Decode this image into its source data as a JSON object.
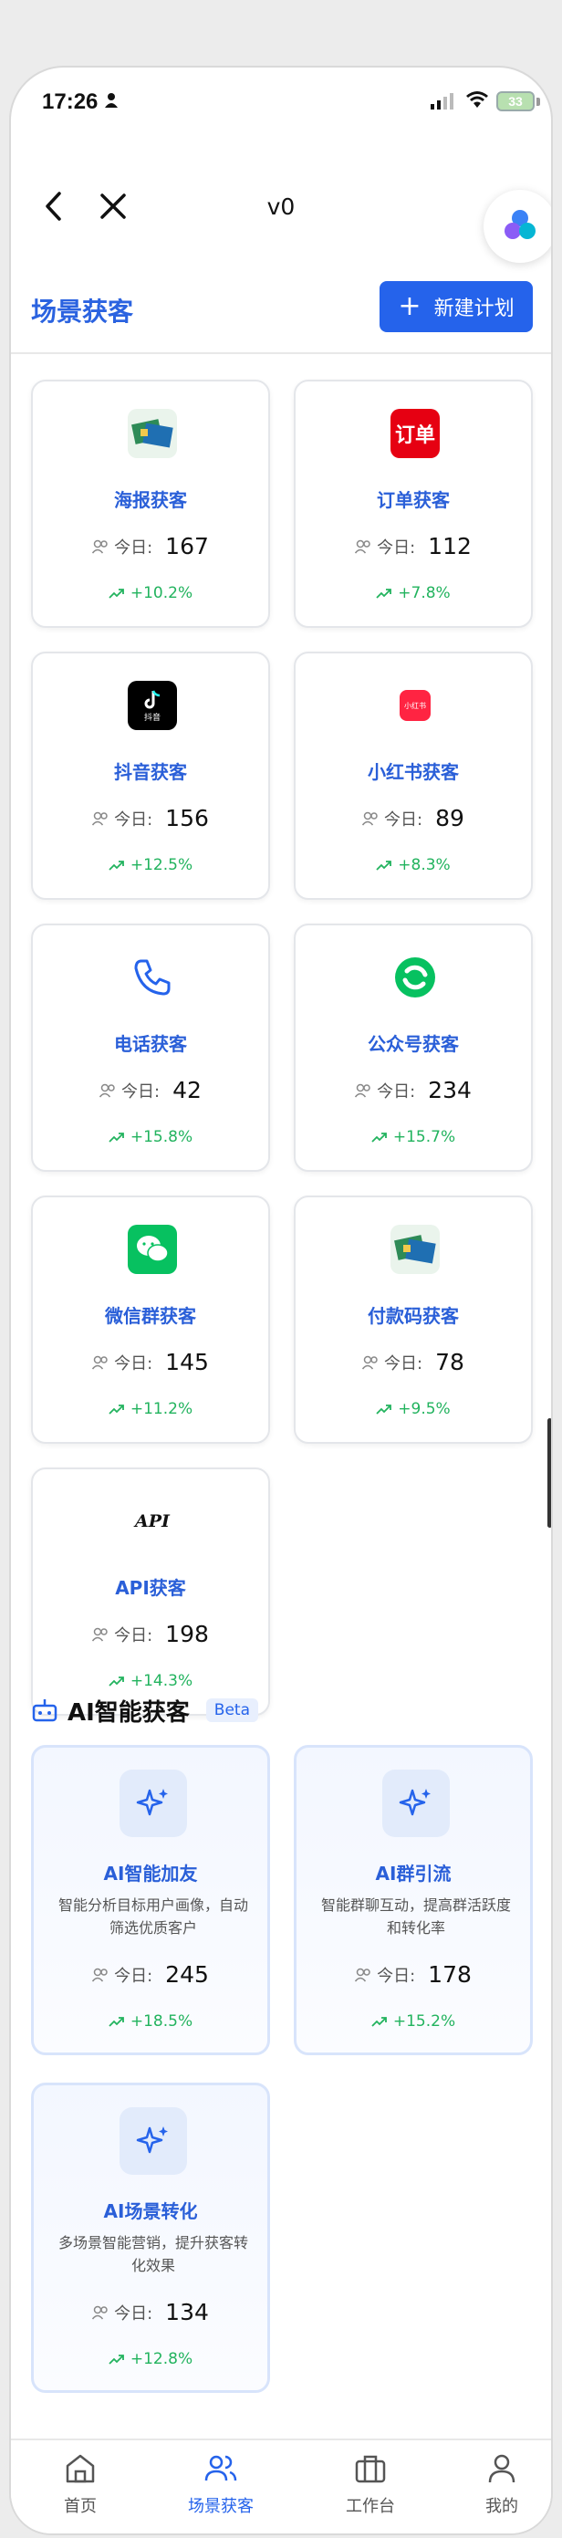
{
  "status_bar": {
    "time": "17:26",
    "battery": "33"
  },
  "nav": {
    "title": "v0"
  },
  "header": {
    "title": "场景获客",
    "new_plan_label": "新建计划"
  },
  "today_label": "今日:",
  "channels": [
    {
      "name": "海报获客",
      "today": "167",
      "trend": "+10.2%",
      "icon": "poster-icon"
    },
    {
      "name": "订单获客",
      "today": "112",
      "trend": "+7.8%",
      "icon": "order-icon",
      "icon_text": "订单"
    },
    {
      "name": "抖音获客",
      "today": "156",
      "trend": "+12.5%",
      "icon": "douyin-icon",
      "icon_text": "抖音"
    },
    {
      "name": "小红书获客",
      "today": "89",
      "trend": "+8.3%",
      "icon": "xiaohongshu-icon",
      "icon_text": "小红书"
    },
    {
      "name": "电话获客",
      "today": "42",
      "trend": "+15.8%",
      "icon": "phone-icon"
    },
    {
      "name": "公众号获客",
      "today": "234",
      "trend": "+15.7%",
      "icon": "official-account-icon"
    },
    {
      "name": "微信群获客",
      "today": "145",
      "trend": "+11.2%",
      "icon": "wechat-group-icon"
    },
    {
      "name": "付款码获客",
      "today": "78",
      "trend": "+9.5%",
      "icon": "payment-code-icon"
    },
    {
      "name": "API获客",
      "today": "198",
      "trend": "+14.3%",
      "icon": "api-icon",
      "icon_text": "API"
    }
  ],
  "ai_section": {
    "title": "AI智能获客",
    "badge": "Beta"
  },
  "ai_channels": [
    {
      "name": "AI智能加友",
      "desc": "智能分析目标用户画像，自动筛选优质客户",
      "today": "245",
      "trend": "+18.5%"
    },
    {
      "name": "AI群引流",
      "desc": "智能群聊互动，提高群活跃度和转化率",
      "today": "178",
      "trend": "+15.2%"
    },
    {
      "name": "AI场景转化",
      "desc": "多场景智能营销，提升获客转化效果",
      "today": "134",
      "trend": "+12.8%"
    }
  ],
  "tabbar": [
    {
      "label": "首页",
      "icon": "home-icon"
    },
    {
      "label": "场景获客",
      "icon": "users-icon",
      "active": true
    },
    {
      "label": "工作台",
      "icon": "briefcase-icon"
    },
    {
      "label": "我的",
      "icon": "user-icon"
    }
  ],
  "colors": {
    "accent": "#2563eb",
    "up": "#22b35e"
  }
}
